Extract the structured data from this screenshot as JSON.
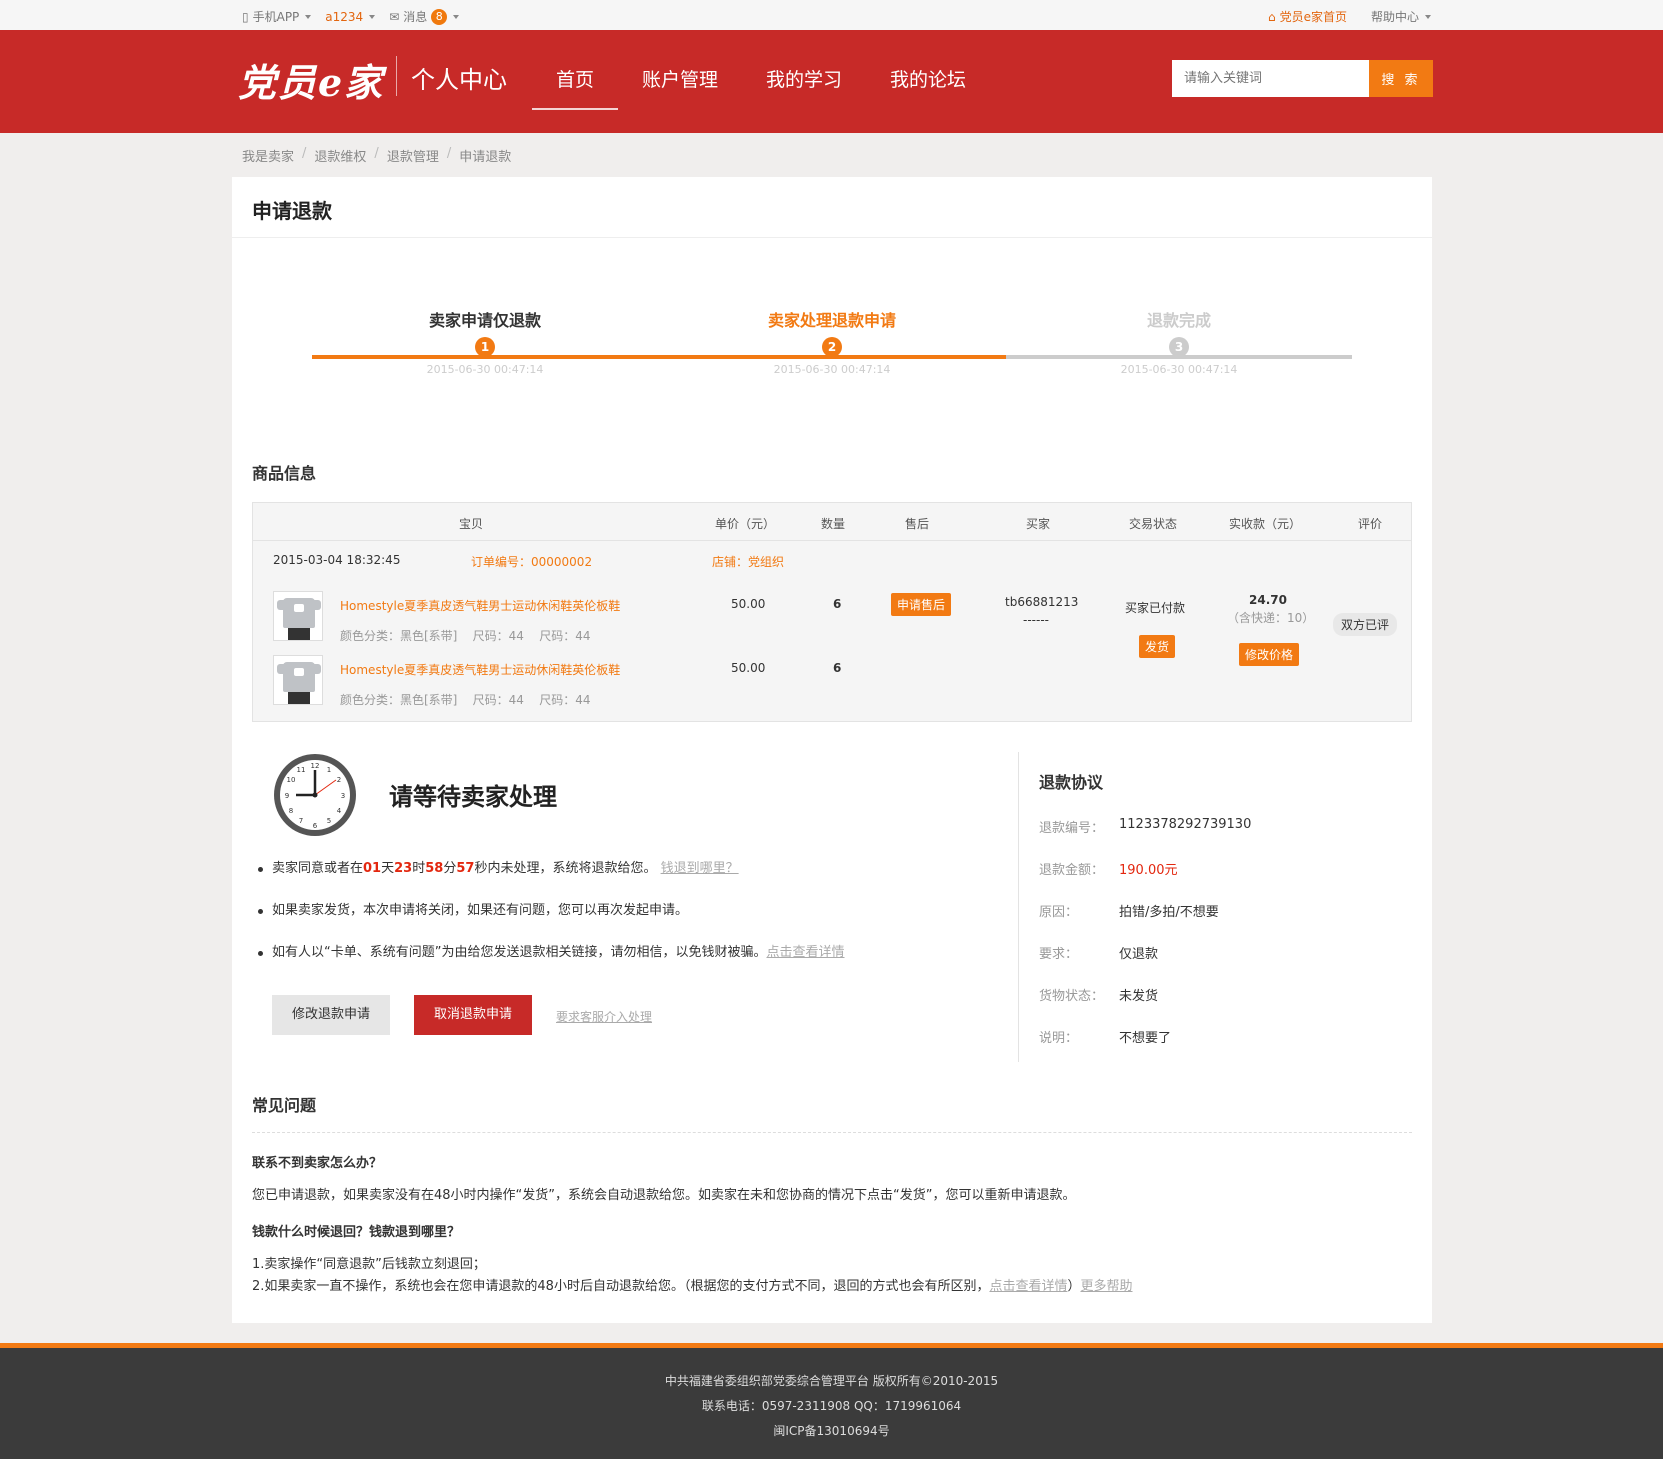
{
  "topbar": {
    "app": "手机APP",
    "user": "a1234",
    "messages": "消息",
    "message_count": "8",
    "home_link": "党员e家首页",
    "help": "帮助中心"
  },
  "header": {
    "logo": "党员e家",
    "subtitle": "个人中心",
    "nav": [
      "首页",
      "账户管理",
      "我的学习",
      "我的论坛"
    ],
    "search_placeholder": "请输入关键词",
    "search_button": "搜 索"
  },
  "breadcrumb": [
    "我是卖家",
    "退款维权",
    "退款管理",
    "申请退款"
  ],
  "page_title": "申请退款",
  "steps": [
    {
      "num": "1",
      "label": "卖家申请仅退款",
      "date": "2015-06-30 00:47:14"
    },
    {
      "num": "2",
      "label": "卖家处理退款申请",
      "date": "2015-06-30 00:47:14"
    },
    {
      "num": "3",
      "label": "退款完成",
      "date": "2015-06-30 00:47:14"
    }
  ],
  "goods": {
    "title": "商品信息",
    "headers": [
      "宝贝",
      "单价（元）",
      "数量",
      "售后",
      "买家",
      "交易状态",
      "实收款（元）",
      "评价"
    ],
    "order_time": "2015-03-04 18:32:45",
    "order_no": "订单编号：00000002",
    "shop": "店铺：党组织",
    "items": [
      {
        "name": "Homestyle夏季真皮透气鞋男士运动休闲鞋英伦板鞋",
        "spec": [
          "颜色分类：黑色[系带]",
          "尺码：44",
          "尺码：44"
        ],
        "price": "50.00",
        "qty": "6"
      },
      {
        "name": "Homestyle夏季真皮透气鞋男士运动休闲鞋英伦板鞋",
        "spec": [
          "颜色分类：黑色[系带]",
          "尺码：44",
          "尺码：44"
        ],
        "price": "50.00",
        "qty": "6"
      }
    ],
    "after_sale_btn": "申请售后",
    "buyer": "tb66881213",
    "buyer_sub": "------",
    "trade_status": "买家已付款",
    "ship_btn": "发货",
    "received": "24.70",
    "received_sub": "（含快递：10）",
    "modify_price_btn": "修改价格",
    "rating": "双方已评"
  },
  "wait": {
    "title": "请等待卖家处理",
    "tip1_pre": "卖家同意或者在",
    "days": "01",
    "d": "天",
    "hours": "23",
    "h": "时",
    "mins": "58",
    "m": "分",
    "secs": "57",
    "tip1_post": "秒内未处理，系统将退款给您。",
    "tip1_link": "钱退到哪里？",
    "tip2": "如果卖家发货，本次申请将关闭，如果还有问题，您可以再次发起申请。",
    "tip3": "如有人以“卡单、系统有问题”为由给您发送退款相关链接，请勿相信，以免钱财被骗。",
    "tip3_link": "点击查看详情",
    "btn_modify": "修改退款申请",
    "btn_cancel": "取消退款申请",
    "btn_service": "要求客服介入处理"
  },
  "agreement": {
    "title": "退款协议",
    "rows": [
      {
        "k": "退款编号：",
        "v": "1123378292739130"
      },
      {
        "k": "退款金额：",
        "v": "190.00元"
      },
      {
        "k": "原因：",
        "v": "拍错/多拍/不想要"
      },
      {
        "k": "要求：",
        "v": "仅退款"
      },
      {
        "k": "货物状态：",
        "v": "未发货"
      },
      {
        "k": "说明：",
        "v": "不想要了"
      }
    ]
  },
  "faq": {
    "title": "常见问题",
    "q1": "联系不到卖家怎么办？",
    "a1": "您已申请退款，如果卖家没有在48小时内操作“发货”，系统会自动退款给您。如卖家在未和您协商的情况下点击“发货”，您可以重新申请退款。",
    "q2": "钱款什么时候退回？钱款退到哪里？",
    "a2_1": "1.卖家操作“同意退款”后钱款立刻退回；",
    "a2_2": "2.如果卖家一直不操作，系统也会在您申请退款的48小时后自动退款给您。（根据您的支付方式不同，退回的方式也会有所区别，",
    "a2_link": "点击查看详情",
    "a2_end": "）",
    "more": "更多帮助"
  },
  "footer": {
    "line1": "中共福建省委组织部党委综合管理平台 版权所有©2010-2015",
    "line2": "联系电话：0597-2311908    QQ：1719961064",
    "line3": "闽ICP备13010694号"
  },
  "colors": {
    "brand_red": "#c72a28",
    "accent_orange": "#f27a13"
  }
}
